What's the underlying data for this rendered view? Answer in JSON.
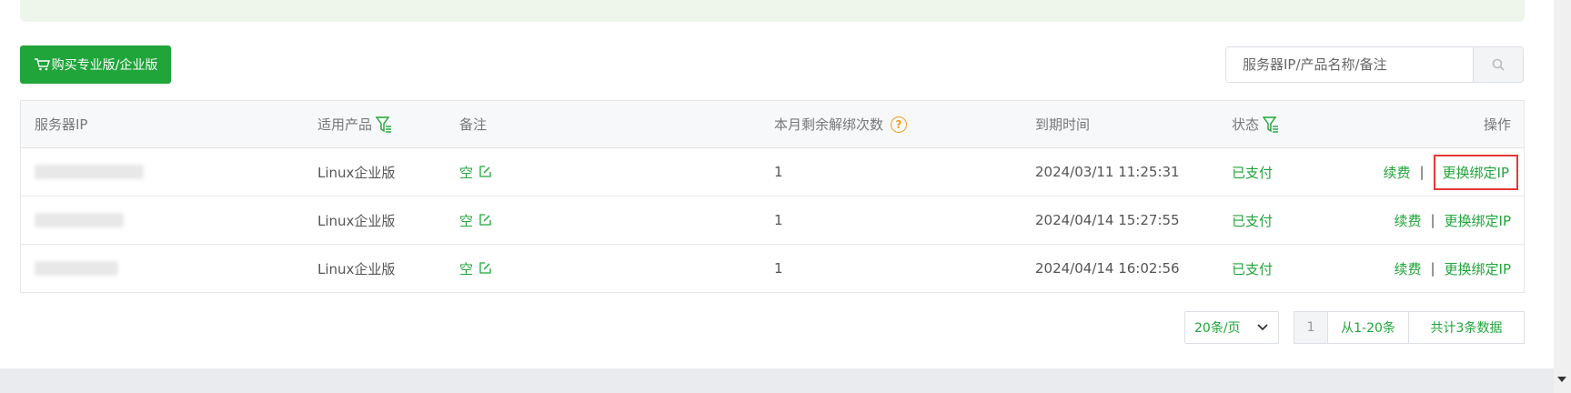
{
  "toolbar": {
    "buy_label": "购买专业版/企业版",
    "search_placeholder": "服务器IP/产品名称/备注"
  },
  "table": {
    "headers": {
      "ip": "服务器IP",
      "product": "适用产品",
      "note": "备注",
      "count": "本月剩余解绑次数",
      "expire": "到期时间",
      "status": "状态",
      "operation": "操作"
    },
    "rows": [
      {
        "product": "Linux企业版",
        "note": "空",
        "count": "1",
        "expire": "2024/03/11 11:25:31",
        "status": "已支付",
        "renew": "续费",
        "change_ip": "更换绑定IP"
      },
      {
        "product": "Linux企业版",
        "note": "空",
        "count": "1",
        "expire": "2024/04/14 15:27:55",
        "status": "已支付",
        "renew": "续费",
        "change_ip": "更换绑定IP"
      },
      {
        "product": "Linux企业版",
        "note": "空",
        "count": "1",
        "expire": "2024/04/14 16:02:56",
        "status": "已支付",
        "renew": "续费",
        "change_ip": "更换绑定IP"
      }
    ],
    "separator": "|"
  },
  "pagination": {
    "page_size": "20条/页",
    "current_page": "1",
    "range": "从1-20条",
    "total": "共计3条数据"
  },
  "colors": {
    "accent": "#20a53a",
    "highlight_border": "#e53935",
    "help_icon": "#f0a020"
  }
}
